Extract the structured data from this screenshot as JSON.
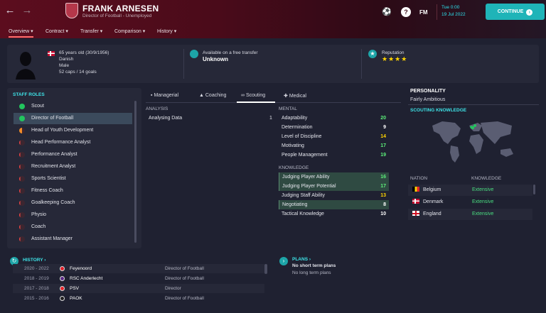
{
  "header": {
    "name": "FRANK ARNESEN",
    "subtitle": "Director of Football - Unemployed",
    "fm": "FM",
    "time": "Tue 0:00",
    "date": "19 Jul 2022",
    "continue_label": "CONTINUE"
  },
  "tabs": [
    "Overview",
    "Contract",
    "Transfer",
    "Comparison",
    "History"
  ],
  "info": {
    "age": "65 years old (30/9/1956)",
    "nationality": "Danish",
    "gender": "Male",
    "caps": "52 caps / 14 goals",
    "transfer_status": "Available on a free transfer",
    "transfer_value": "Unknown",
    "reputation_label": "Reputation",
    "reputation_stars": "★★★★"
  },
  "staff_roles": {
    "heading": "STAFF ROLES",
    "items": [
      {
        "label": "Scout",
        "level": "green"
      },
      {
        "label": "Director of Football",
        "level": "green"
      },
      {
        "label": "Head of Youth Development",
        "level": "half"
      },
      {
        "label": "Head Performance Analyst",
        "level": "low"
      },
      {
        "label": "Performance Analyst",
        "level": "low"
      },
      {
        "label": "Recruitment Analyst",
        "level": "low"
      },
      {
        "label": "Sports Scientist",
        "level": "low"
      },
      {
        "label": "Fitness Coach",
        "level": "low"
      },
      {
        "label": "Goalkeeping Coach",
        "level": "low"
      },
      {
        "label": "Physio",
        "level": "low"
      },
      {
        "label": "Coach",
        "level": "low"
      },
      {
        "label": "Assistant Manager",
        "level": "low"
      }
    ]
  },
  "attr_tabs": [
    "Managerial",
    "Coaching",
    "Scouting",
    "Medical"
  ],
  "analysis": {
    "heading": "ANALYSIS",
    "label": "Analysing Data",
    "value": "1"
  },
  "mental": {
    "heading": "MENTAL",
    "items": [
      {
        "label": "Adaptability",
        "value": "20",
        "color": "g"
      },
      {
        "label": "Determination",
        "value": "9",
        "color": "w"
      },
      {
        "label": "Level of Discipline",
        "value": "14",
        "color": "y"
      },
      {
        "label": "Motivating",
        "value": "17",
        "color": "g"
      },
      {
        "label": "People Management",
        "value": "19",
        "color": "g"
      }
    ]
  },
  "knowledge": {
    "heading": "KNOWLEDGE",
    "items": [
      {
        "label": "Judging Player Ability",
        "value": "16",
        "color": "g",
        "hl": true
      },
      {
        "label": "Judging Player Potential",
        "value": "17",
        "color": "g",
        "hl": true
      },
      {
        "label": "Judging Staff Ability",
        "value": "13",
        "color": "y",
        "hl": false
      },
      {
        "label": "Negotiating",
        "value": "8",
        "color": "w",
        "hl": true
      },
      {
        "label": "Tactical Knowledge",
        "value": "10",
        "color": "w",
        "hl": false
      }
    ]
  },
  "personality": {
    "heading": "PERSONALITY",
    "value": "Fairly Ambitious"
  },
  "scouting_knowledge": {
    "heading": "SCOUTING KNOWLEDGE",
    "col_nation": "NATION",
    "col_knowledge": "KNOWLEDGE",
    "rows": [
      {
        "nation": "Belgium",
        "flag": "be",
        "knowledge": "Extensive"
      },
      {
        "nation": "Denmark",
        "flag": "dk",
        "knowledge": "Extensive"
      },
      {
        "nation": "England",
        "flag": "en",
        "knowledge": "Extensive"
      }
    ]
  },
  "history": {
    "heading": "HISTORY",
    "rows": [
      {
        "years": "2020 - 2022",
        "club": "Feyenoord",
        "role": "Director of Football",
        "crest": "#e0202a"
      },
      {
        "years": "2018 - 2019",
        "club": "RSC Anderlecht",
        "role": "Director of Football",
        "crest": "#5b2a86"
      },
      {
        "years": "2017 - 2018",
        "club": "PSV",
        "role": "Director",
        "crest": "#e3252b"
      },
      {
        "years": "2015 - 2016",
        "club": "PAOK",
        "role": "Director of Football",
        "crest": "#222222"
      }
    ]
  },
  "plans": {
    "heading": "PLANS",
    "short": "No short term plans",
    "long": "No long term plans"
  }
}
